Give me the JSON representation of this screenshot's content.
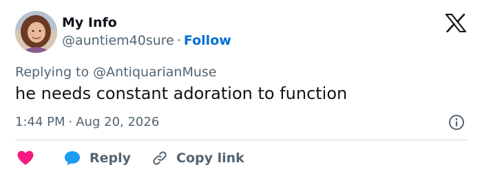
{
  "author": {
    "display_name": "My Info",
    "handle": "@auntiem40sure",
    "separator": "·",
    "follow_label": "Follow"
  },
  "reply_context": {
    "prefix": "Replying to",
    "mention": "@AntiquarianMuse"
  },
  "tweet": {
    "text": "he needs constant adoration to function"
  },
  "meta": {
    "time": "1:44 PM",
    "separator": "·",
    "date": "Aug 20, 2026"
  },
  "actions": {
    "reply_label": "Reply",
    "copy_link_label": "Copy link"
  },
  "icons": {
    "brand": "x-logo-icon",
    "info": "info-icon",
    "like": "heart-icon",
    "reply": "speech-bubble-icon",
    "copy": "link-icon"
  },
  "colors": {
    "text_primary": "#0f1419",
    "text_secondary": "#536471",
    "follow": "#006fd6",
    "heart": "#f91880",
    "reply_bubble": "#1d9bf0",
    "divider": "#cfd9de"
  }
}
